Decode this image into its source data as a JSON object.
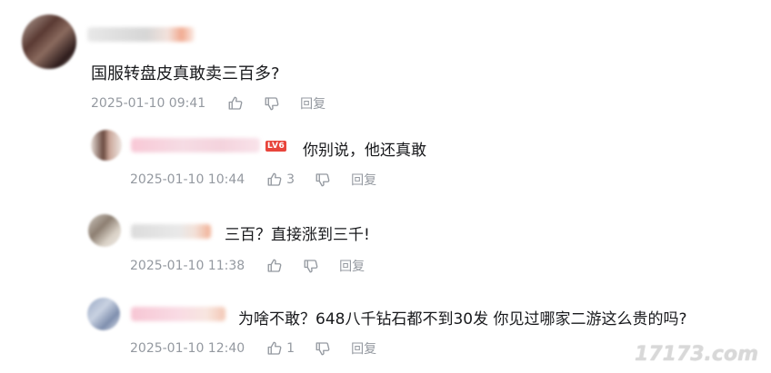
{
  "comments": [
    {
      "text": "国服转盘皮真敢卖三百多?",
      "time": "2025-01-10 09:41",
      "likes": "",
      "reply_label": "回复"
    }
  ],
  "replies": [
    {
      "text": "你别说，他还真敢",
      "level": "LV6",
      "time": "2025-01-10 10:44",
      "likes": "3",
      "reply_label": "回复"
    },
    {
      "text": "三百？直接涨到三千!",
      "time": "2025-01-10 11:38",
      "likes": "",
      "reply_label": "回复"
    },
    {
      "text": "为啥不敢？648八千钻石都不到30发 你见过哪家二游这么贵的吗?",
      "time": "2025-01-10 12:40",
      "likes": "1",
      "reply_label": "回复"
    }
  ],
  "icons": {
    "like": "thumbs-up-icon",
    "dislike": "thumbs-down-icon"
  },
  "watermark": "17173.com"
}
